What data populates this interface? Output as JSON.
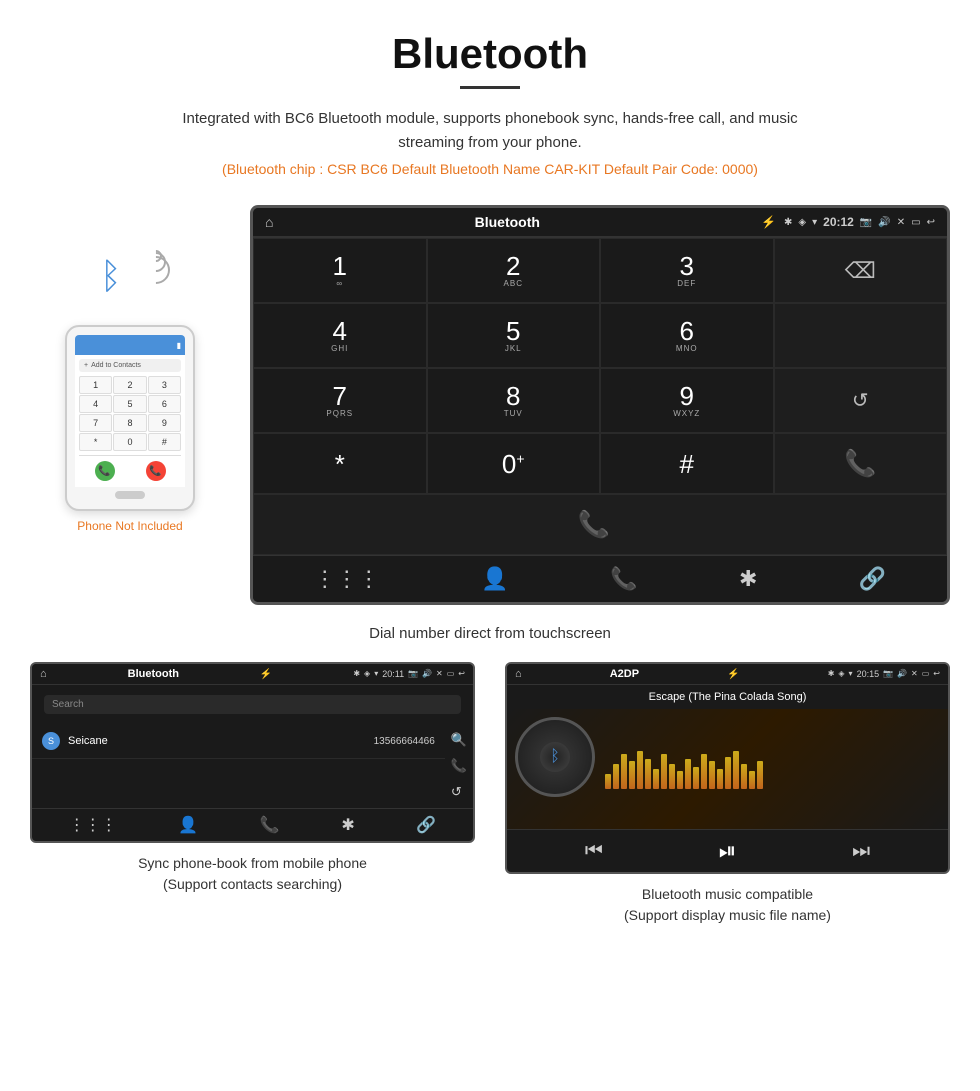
{
  "page": {
    "title": "Bluetooth",
    "title_underline": true,
    "description": "Integrated with BC6 Bluetooth module, supports phonebook sync, hands-free call, and music streaming from your phone.",
    "bluetooth_info": "(Bluetooth chip : CSR BC6    Default Bluetooth Name CAR-KIT    Default Pair Code: 0000)",
    "main_caption": "Dial number direct from touchscreen",
    "phone_not_included": "Phone Not Included"
  },
  "car_display": {
    "app_title": "Bluetooth",
    "time": "20:12",
    "usb_icon": "⚡",
    "home_icon": "⌂",
    "dialpad": {
      "rows": [
        [
          {
            "num": "1",
            "letters": "∞",
            "type": "key"
          },
          {
            "num": "2",
            "letters": "ABC",
            "type": "key"
          },
          {
            "num": "3",
            "letters": "DEF",
            "type": "key"
          },
          {
            "type": "backspace"
          }
        ],
        [
          {
            "num": "4",
            "letters": "GHI",
            "type": "key"
          },
          {
            "num": "5",
            "letters": "JKL",
            "type": "key"
          },
          {
            "num": "6",
            "letters": "MNO",
            "type": "key"
          },
          {
            "type": "empty"
          }
        ],
        [
          {
            "num": "7",
            "letters": "PQRS",
            "type": "key"
          },
          {
            "num": "8",
            "letters": "TUV",
            "type": "key"
          },
          {
            "num": "9",
            "letters": "WXYZ",
            "type": "key"
          },
          {
            "type": "redial"
          }
        ],
        [
          {
            "num": "*",
            "letters": "",
            "type": "key"
          },
          {
            "num": "0",
            "letters": "+",
            "type": "key0"
          },
          {
            "num": "#",
            "letters": "",
            "type": "key"
          },
          {
            "type": "call_green"
          }
        ],
        [
          {
            "type": "call_end"
          }
        ]
      ],
      "func_bar": [
        "⋮⋮⋮",
        "👤",
        "📞",
        "✱",
        "🔗"
      ]
    }
  },
  "phonebook_screen": {
    "app_title": "Bluetooth",
    "time": "20:11",
    "search_placeholder": "Search",
    "contacts": [
      {
        "initial": "S",
        "name": "Seicane",
        "phone": "13566664466"
      }
    ],
    "func_bar": [
      "⋮⋮⋮",
      "👤",
      "📞",
      "✱",
      "🔗"
    ],
    "caption_line1": "Sync phone-book from mobile phone",
    "caption_line2": "(Support contacts searching)"
  },
  "music_screen": {
    "app_title": "A2DP",
    "time": "20:15",
    "song_title": "Escape (The Pina Colada Song)",
    "eq_bars": [
      15,
      25,
      35,
      28,
      38,
      30,
      20,
      35,
      25,
      18,
      30,
      22,
      35,
      28,
      20,
      32,
      38,
      25,
      18,
      28
    ],
    "controls": [
      "⏮",
      "⏯",
      "⏭"
    ],
    "caption_line1": "Bluetooth music compatible",
    "caption_line2": "(Support display music file name)"
  },
  "phone_mockup": {
    "keys": [
      "1",
      "2",
      "3",
      "4",
      "5",
      "6",
      "7",
      "8",
      "9",
      "*",
      "0",
      "#"
    ]
  }
}
